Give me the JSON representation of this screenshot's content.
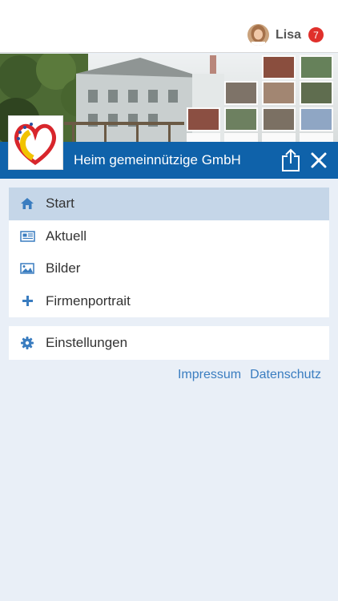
{
  "header": {
    "user_name": "Lisa",
    "notification_count": "7",
    "avatar": "user-avatar"
  },
  "brand_bar": {
    "title": "Heim gemeinnützige GmbH",
    "share_icon": "share-icon",
    "close_icon": "close-icon"
  },
  "menu": {
    "items": [
      {
        "label": "Start",
        "icon": "home-icon",
        "active": true
      },
      {
        "label": "Aktuell",
        "icon": "news-icon",
        "active": false
      },
      {
        "label": "Bilder",
        "icon": "image-icon",
        "active": false
      },
      {
        "label": "Firmenportrait",
        "icon": "plus-icon",
        "active": false
      }
    ],
    "settings": {
      "label": "Einstellungen",
      "icon": "gear-icon"
    }
  },
  "footer_links": {
    "impressum": "Impressum",
    "datenschutz": "Datenschutz"
  },
  "colors": {
    "brand_blue": "#0f62aa",
    "active_bg": "#c5d6e8",
    "icon_blue": "#3a7dc0",
    "badge_red": "#e0302b",
    "page_bg": "#e9eff7"
  }
}
